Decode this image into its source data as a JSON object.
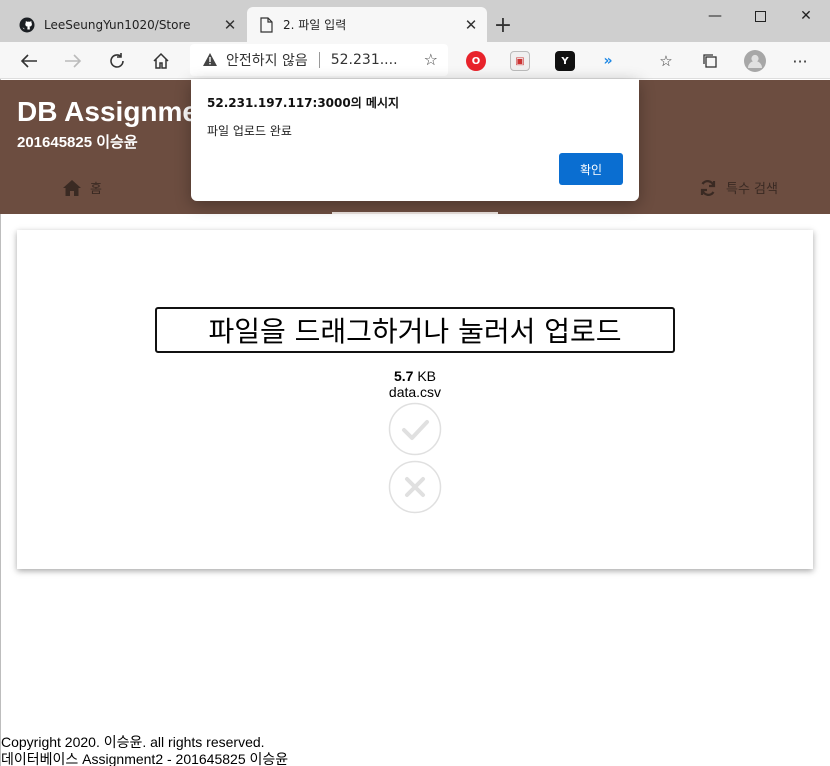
{
  "browser": {
    "tabs": [
      {
        "title": "LeeSeungYun1020/Store",
        "icon": "github-icon",
        "active": false
      },
      {
        "title": "2. 파일 입력",
        "icon": "page-icon",
        "active": true
      }
    ],
    "address": {
      "security_label": "안전하지 않음",
      "url": "52.231...."
    }
  },
  "header": {
    "title": "DB Assignment2",
    "subtitle": "201645825 이승윤",
    "nav": {
      "home": "홈",
      "special_search": "특수 검색"
    }
  },
  "dialog": {
    "title": "52.231.197.117:3000의 메시지",
    "message": "파일 업로드 완료",
    "ok_label": "확인"
  },
  "upload": {
    "dropzone_text": "파일을 드래그하거나 눌러서 업로드",
    "file_size_value": "5.7",
    "file_size_unit": "KB",
    "file_name": "data.csv"
  },
  "footer": {
    "copyright": "Copyright 2020. 이승윤. all rights reserved.",
    "credit": "데이터베이스 Assignment2 - 201645825 이승윤"
  },
  "colors": {
    "header_bg": "#6c4d40",
    "accent_button": "#0a6ed1"
  }
}
